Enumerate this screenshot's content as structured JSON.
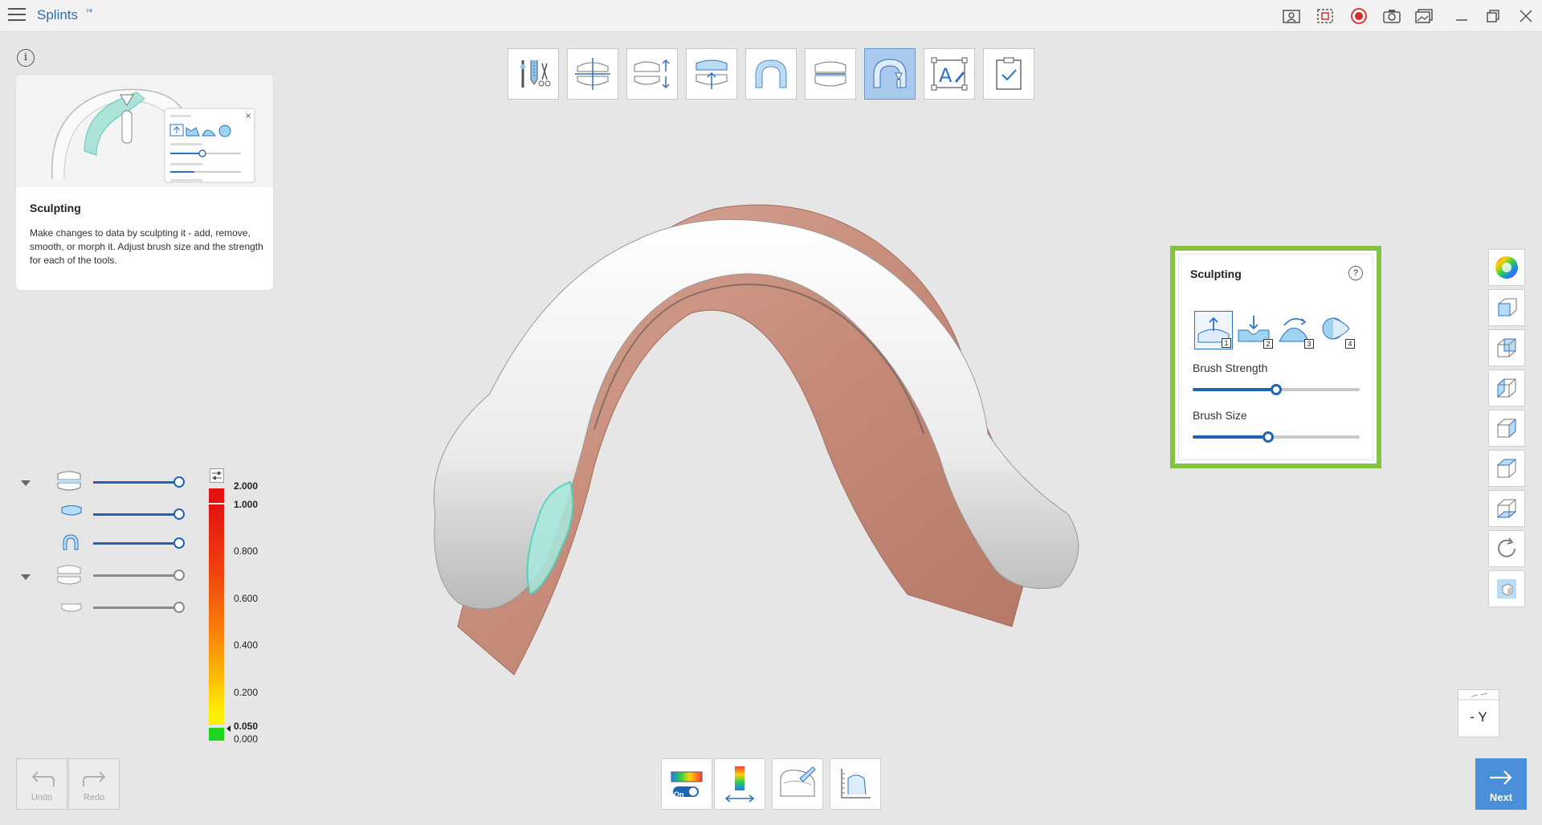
{
  "app": {
    "title": "Splints",
    "title_badge": "⁷⁸"
  },
  "titlebar_icons": [
    "guide-icon",
    "capture-region-icon",
    "record-icon",
    "screenshot-icon",
    "gallery-icon",
    "minimize-icon",
    "restore-icon",
    "close-icon"
  ],
  "info_card": {
    "heading": "Sculpting",
    "text": "Make changes to data by sculpting it - add, remove, smooth, or morph it. Adjust brush size and the strength for each of the tools."
  },
  "steps": [
    {
      "name": "trim-step",
      "active": false
    },
    {
      "name": "align-step",
      "active": false
    },
    {
      "name": "bite-adjust-step",
      "active": false
    },
    {
      "name": "insertion-step",
      "active": false
    },
    {
      "name": "splint-design-step",
      "active": false
    },
    {
      "name": "occlusion-step",
      "active": false
    },
    {
      "name": "sculpting-step",
      "active": true
    },
    {
      "name": "text-step",
      "active": false
    },
    {
      "name": "finish-step",
      "active": false
    }
  ],
  "visibility": {
    "rows": [
      {
        "name": "upper-group",
        "level": 1.0,
        "color": "#1e64b4"
      },
      {
        "name": "upper-splint",
        "level": 1.0,
        "color": "#1e64b4"
      },
      {
        "name": "arch",
        "level": 1.0,
        "color": "#1e64b4"
      },
      {
        "name": "lower-group",
        "level": 1.0,
        "color": "#8a8a8a"
      },
      {
        "name": "lower-scan",
        "level": 1.0,
        "color": "#8a8a8a"
      }
    ]
  },
  "legend": {
    "labels": [
      "2.000",
      "1.000",
      "0.800",
      "0.600",
      "0.400",
      "0.200",
      "0.050",
      "0.000"
    ]
  },
  "sculpting": {
    "title": "Sculpting",
    "help": "?",
    "tools": [
      {
        "num": "1",
        "name": "add-tool",
        "active": true
      },
      {
        "num": "2",
        "name": "remove-tool",
        "active": false
      },
      {
        "num": "3",
        "name": "smooth-tool",
        "active": false
      },
      {
        "num": "4",
        "name": "morph-tool",
        "active": false
      }
    ],
    "brush_strength_label": "Brush Strength",
    "brush_strength": 0.5,
    "brush_size_label": "Brush Size",
    "brush_size": 0.45
  },
  "view": {
    "axis_label": "- Y"
  },
  "history": {
    "undo": "Undo",
    "redo": "Redo"
  },
  "bottom_tools": {
    "deviation_toggle": "On"
  },
  "next": {
    "label": "Next"
  },
  "colors": {
    "accent": "#1e64b4",
    "highlight": "#83c341",
    "next_bg": "#4a90d9"
  }
}
